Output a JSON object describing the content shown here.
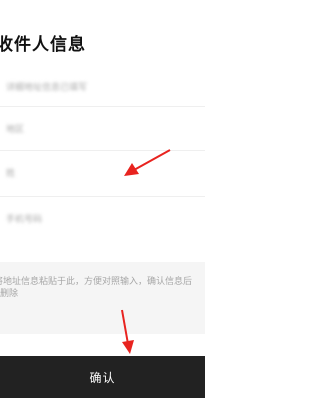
{
  "header": {
    "title": "收件人信息"
  },
  "form": {
    "address": "详细地址信息已填写",
    "region": "地区",
    "name": "姓",
    "phone": "手机号码"
  },
  "paste_area": {
    "placeholder": "将地址信息粘贴于此，方便对照输入，确认信息后删除"
  },
  "footer": {
    "confirm_label": "确认"
  },
  "colors": {
    "arrow": "#e8231f",
    "button_bg": "#222222"
  }
}
